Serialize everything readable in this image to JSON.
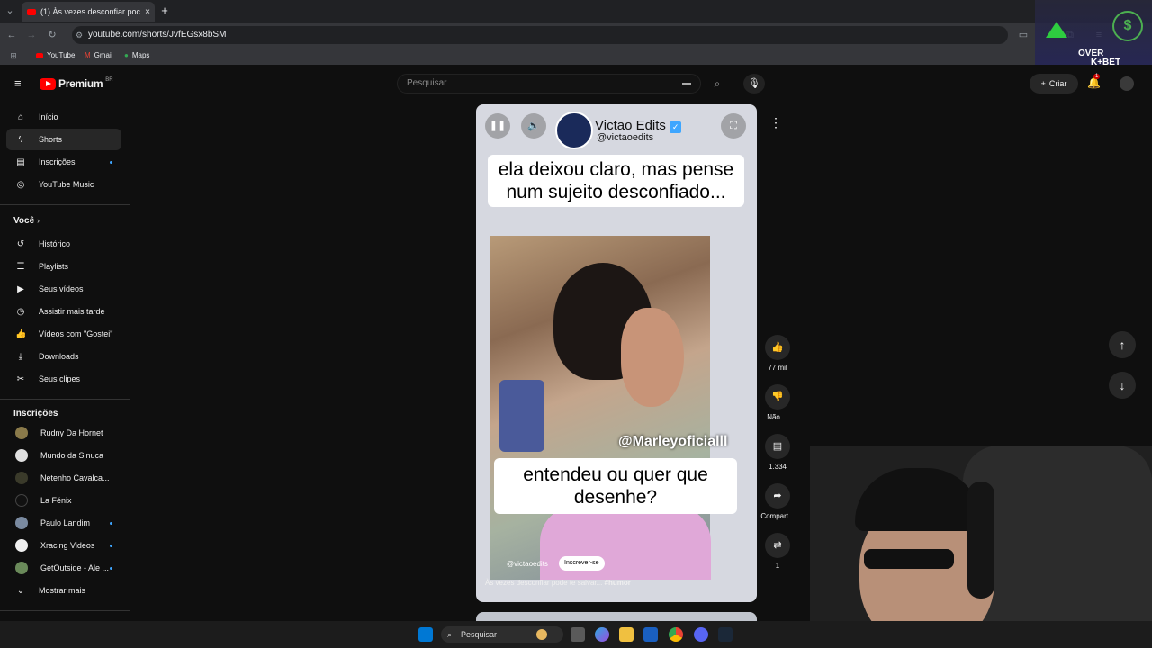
{
  "browser": {
    "tab_title": "(1) Às vezes desconfiar poc",
    "new_tab": "+",
    "url": "youtube.com/shorts/JvfEGsx8bSM",
    "bookmarks": [
      "YouTube",
      "Gmail",
      "Maps"
    ]
  },
  "header": {
    "logo": "Premium",
    "logo_region": "BR",
    "search_placeholder": "Pesquisar",
    "create_label": "Criar",
    "notif_count": "1"
  },
  "sidebar": {
    "main": [
      {
        "label": "Início",
        "icon": "home-icon"
      },
      {
        "label": "Shorts",
        "icon": "shorts-icon"
      },
      {
        "label": "Inscrições",
        "icon": "subscriptions-icon"
      },
      {
        "label": "YouTube Music",
        "icon": "music-icon"
      }
    ],
    "you_title": "Você",
    "you": [
      {
        "label": "Histórico",
        "icon": "history-icon"
      },
      {
        "label": "Playlists",
        "icon": "playlists-icon"
      },
      {
        "label": "Seus vídeos",
        "icon": "your-videos-icon"
      },
      {
        "label": "Assistir mais tarde",
        "icon": "watch-later-icon"
      },
      {
        "label": "Vídeos com \"Gostei\"",
        "icon": "liked-icon"
      },
      {
        "label": "Downloads",
        "icon": "downloads-icon"
      },
      {
        "label": "Seus clipes",
        "icon": "clips-icon"
      }
    ],
    "subs_title": "Inscrições",
    "subs": [
      {
        "label": "Rudny Da Hornet",
        "color": "#8a7a4a"
      },
      {
        "label": "Mundo da Sinuca",
        "color": "#e0e0e0"
      },
      {
        "label": "Netenho Cavalca...",
        "color": "#3a3a2a"
      },
      {
        "label": "La Fénix",
        "color": "#111111"
      },
      {
        "label": "Paulo Landim",
        "color": "#7a8aa0"
      },
      {
        "label": "Xracing Videos",
        "color": "#f0f0f0"
      },
      {
        "label": "GetOutside - Ale ...",
        "color": "#6a8a5a"
      }
    ],
    "show_more": "Mostrar mais"
  },
  "short": {
    "channel_name": "Victao Edits",
    "channel_handle": "@victaoedits",
    "caption_top": "ela deixou claro, mas pense num sujeito desconfiado...",
    "watermark": "@Marleyoficialll",
    "caption_bottom": "entendeu ou quer que desenhe?",
    "footer_handle": "@victaoedits",
    "subscribe": "Inscrever-se",
    "title": "Às vezes desconfiar pode te salvar...",
    "hashtag": "#humor"
  },
  "actions": {
    "likes": "77 mil",
    "dislike": "Não ...",
    "comments": "1.334",
    "share": "Compart...",
    "remix": "1"
  },
  "taskbar": {
    "search": "Pesquisar"
  },
  "overlay_ad": {
    "line1": "OVER",
    "line2": "K+BET"
  },
  "colors": {
    "accent_red": "#ff0000",
    "link_blue": "#3ea6ff"
  }
}
